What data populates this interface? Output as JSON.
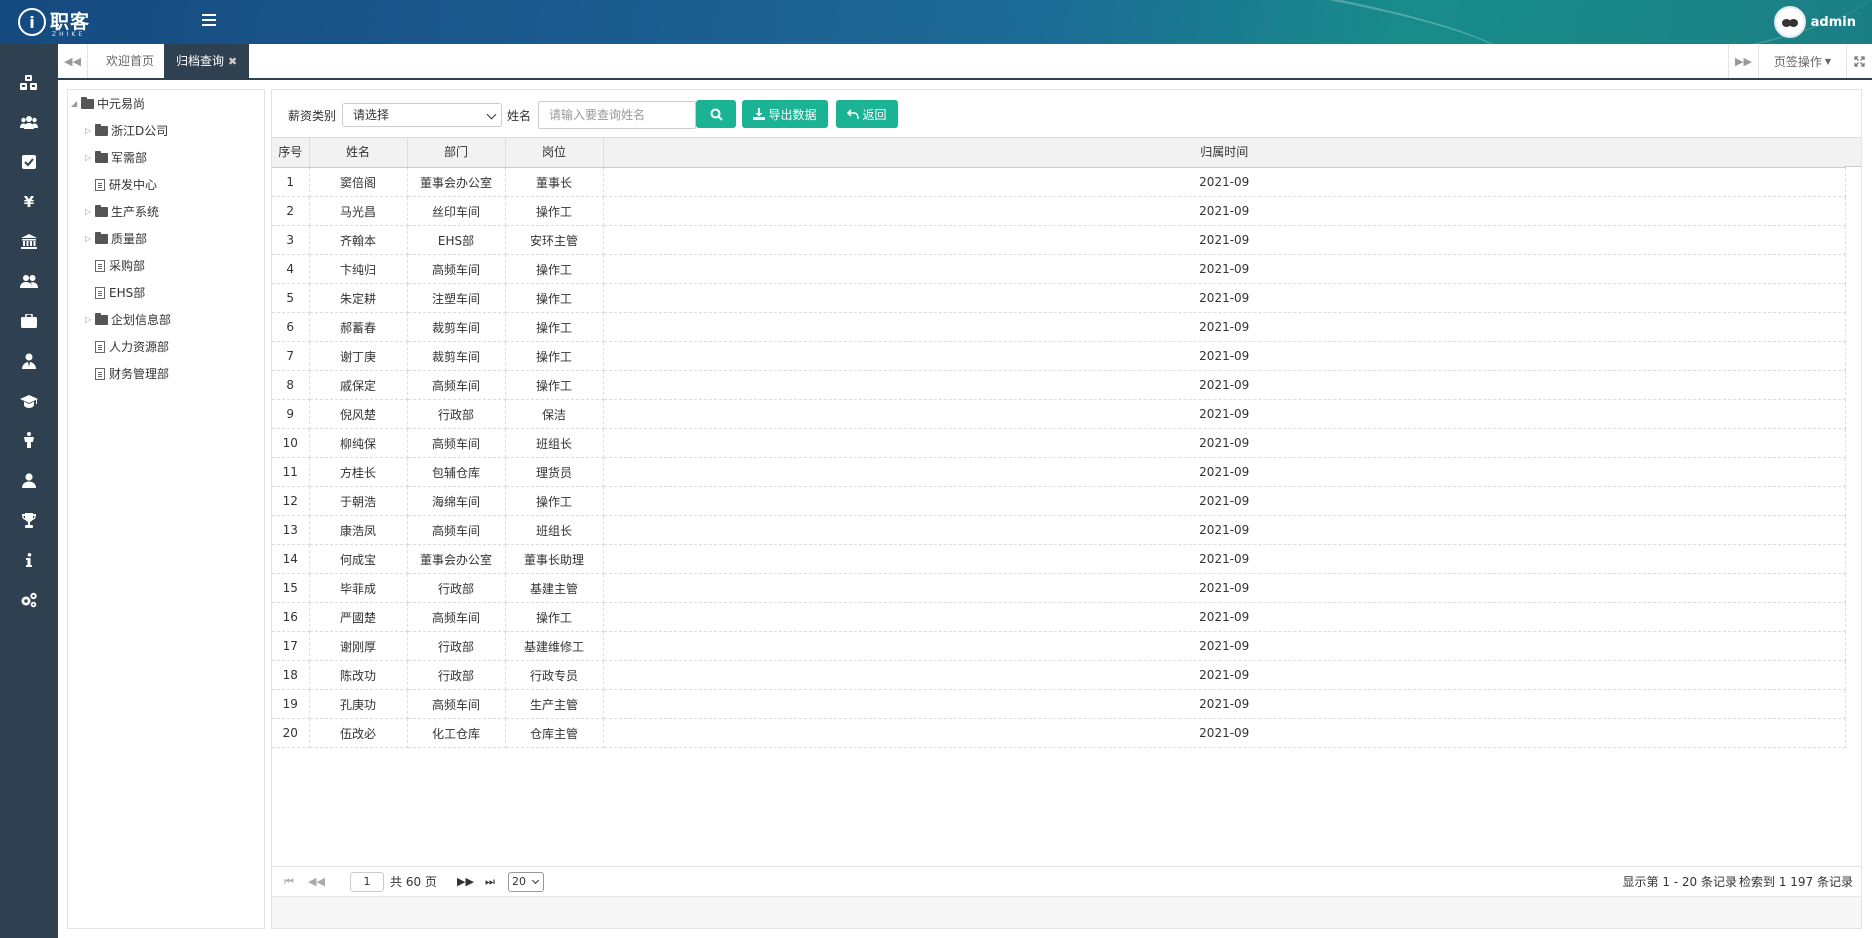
{
  "header": {
    "logo_text": "职客",
    "logo_sub": "ZHIKE",
    "user_name": "admin"
  },
  "sidebar": {
    "icons": [
      "cubes-icon",
      "users-icon",
      "check-square-icon",
      "yen-icon",
      "bank-icon",
      "group-icon",
      "briefcase-icon",
      "user-tie-icon",
      "graduation-cap-icon",
      "male-icon",
      "user-icon",
      "trophy-icon",
      "info-icon",
      "cogs-icon"
    ]
  },
  "tabs": {
    "items": [
      {
        "label": "欢迎首页"
      },
      {
        "label": "归档查询"
      }
    ],
    "page_ops": "页签操作"
  },
  "tree": {
    "root": "中元易尚",
    "nodes": [
      {
        "label": "浙江D公司",
        "type": "folder"
      },
      {
        "label": "军需部",
        "type": "folder"
      },
      {
        "label": "研发中心",
        "type": "doc"
      },
      {
        "label": "生产系统",
        "type": "folder"
      },
      {
        "label": "质量部",
        "type": "folder"
      },
      {
        "label": "采购部",
        "type": "doc"
      },
      {
        "label": "EHS部",
        "type": "doc"
      },
      {
        "label": "企划信息部",
        "type": "folder"
      },
      {
        "label": "人力资源部",
        "type": "doc"
      },
      {
        "label": "财务管理部",
        "type": "doc"
      }
    ]
  },
  "filters": {
    "salary_label": "薪资类别",
    "salary_value": "请选择",
    "name_label": "姓名",
    "name_placeholder": "请输入要查询姓名",
    "export_label": "导出数据",
    "back_label": "返回"
  },
  "table": {
    "columns": [
      "序号",
      "姓名",
      "部门",
      "岗位",
      "归属时间"
    ],
    "rows": [
      [
        "1",
        "窦倍阁",
        "董事会办公室",
        "董事长",
        "2021-09"
      ],
      [
        "2",
        "马光昌",
        "丝印车间",
        "操作工",
        "2021-09"
      ],
      [
        "3",
        "齐翰本",
        "EHS部",
        "安环主管",
        "2021-09"
      ],
      [
        "4",
        "卞纯归",
        "高频车间",
        "操作工",
        "2021-09"
      ],
      [
        "5",
        "朱定耕",
        "注塑车间",
        "操作工",
        "2021-09"
      ],
      [
        "6",
        "郝蓄春",
        "裁剪车间",
        "操作工",
        "2021-09"
      ],
      [
        "7",
        "谢丁庚",
        "裁剪车间",
        "操作工",
        "2021-09"
      ],
      [
        "8",
        "戚保定",
        "高频车间",
        "操作工",
        "2021-09"
      ],
      [
        "9",
        "倪风楚",
        "行政部",
        "保洁",
        "2021-09"
      ],
      [
        "10",
        "柳纯保",
        "高频车间",
        "班组长",
        "2021-09"
      ],
      [
        "11",
        "方桂长",
        "包辅仓库",
        "理货员",
        "2021-09"
      ],
      [
        "12",
        "于朝浩",
        "海绵车间",
        "操作工",
        "2021-09"
      ],
      [
        "13",
        "康浩凤",
        "高频车间",
        "班组长",
        "2021-09"
      ],
      [
        "14",
        "何成宝",
        "董事会办公室",
        "董事长助理",
        "2021-09"
      ],
      [
        "15",
        "毕菲成",
        "行政部",
        "基建主管",
        "2021-09"
      ],
      [
        "16",
        "严國楚",
        "高频车间",
        "操作工",
        "2021-09"
      ],
      [
        "17",
        "谢刚厚",
        "行政部",
        "基建维修工",
        "2021-09"
      ],
      [
        "18",
        "陈改功",
        "行政部",
        "行政专员",
        "2021-09"
      ],
      [
        "19",
        "孔庚功",
        "高频车间",
        "生产主管",
        "2021-09"
      ],
      [
        "20",
        "伍改必",
        "化工仓库",
        "仓库主管",
        "2021-09"
      ]
    ]
  },
  "pager": {
    "page": "1",
    "total_pages_text": "共 60 页",
    "page_size": "20",
    "display_text": "显示第 1 - 20 条记录",
    "found_text": "检索到 1 197 条记录"
  }
}
